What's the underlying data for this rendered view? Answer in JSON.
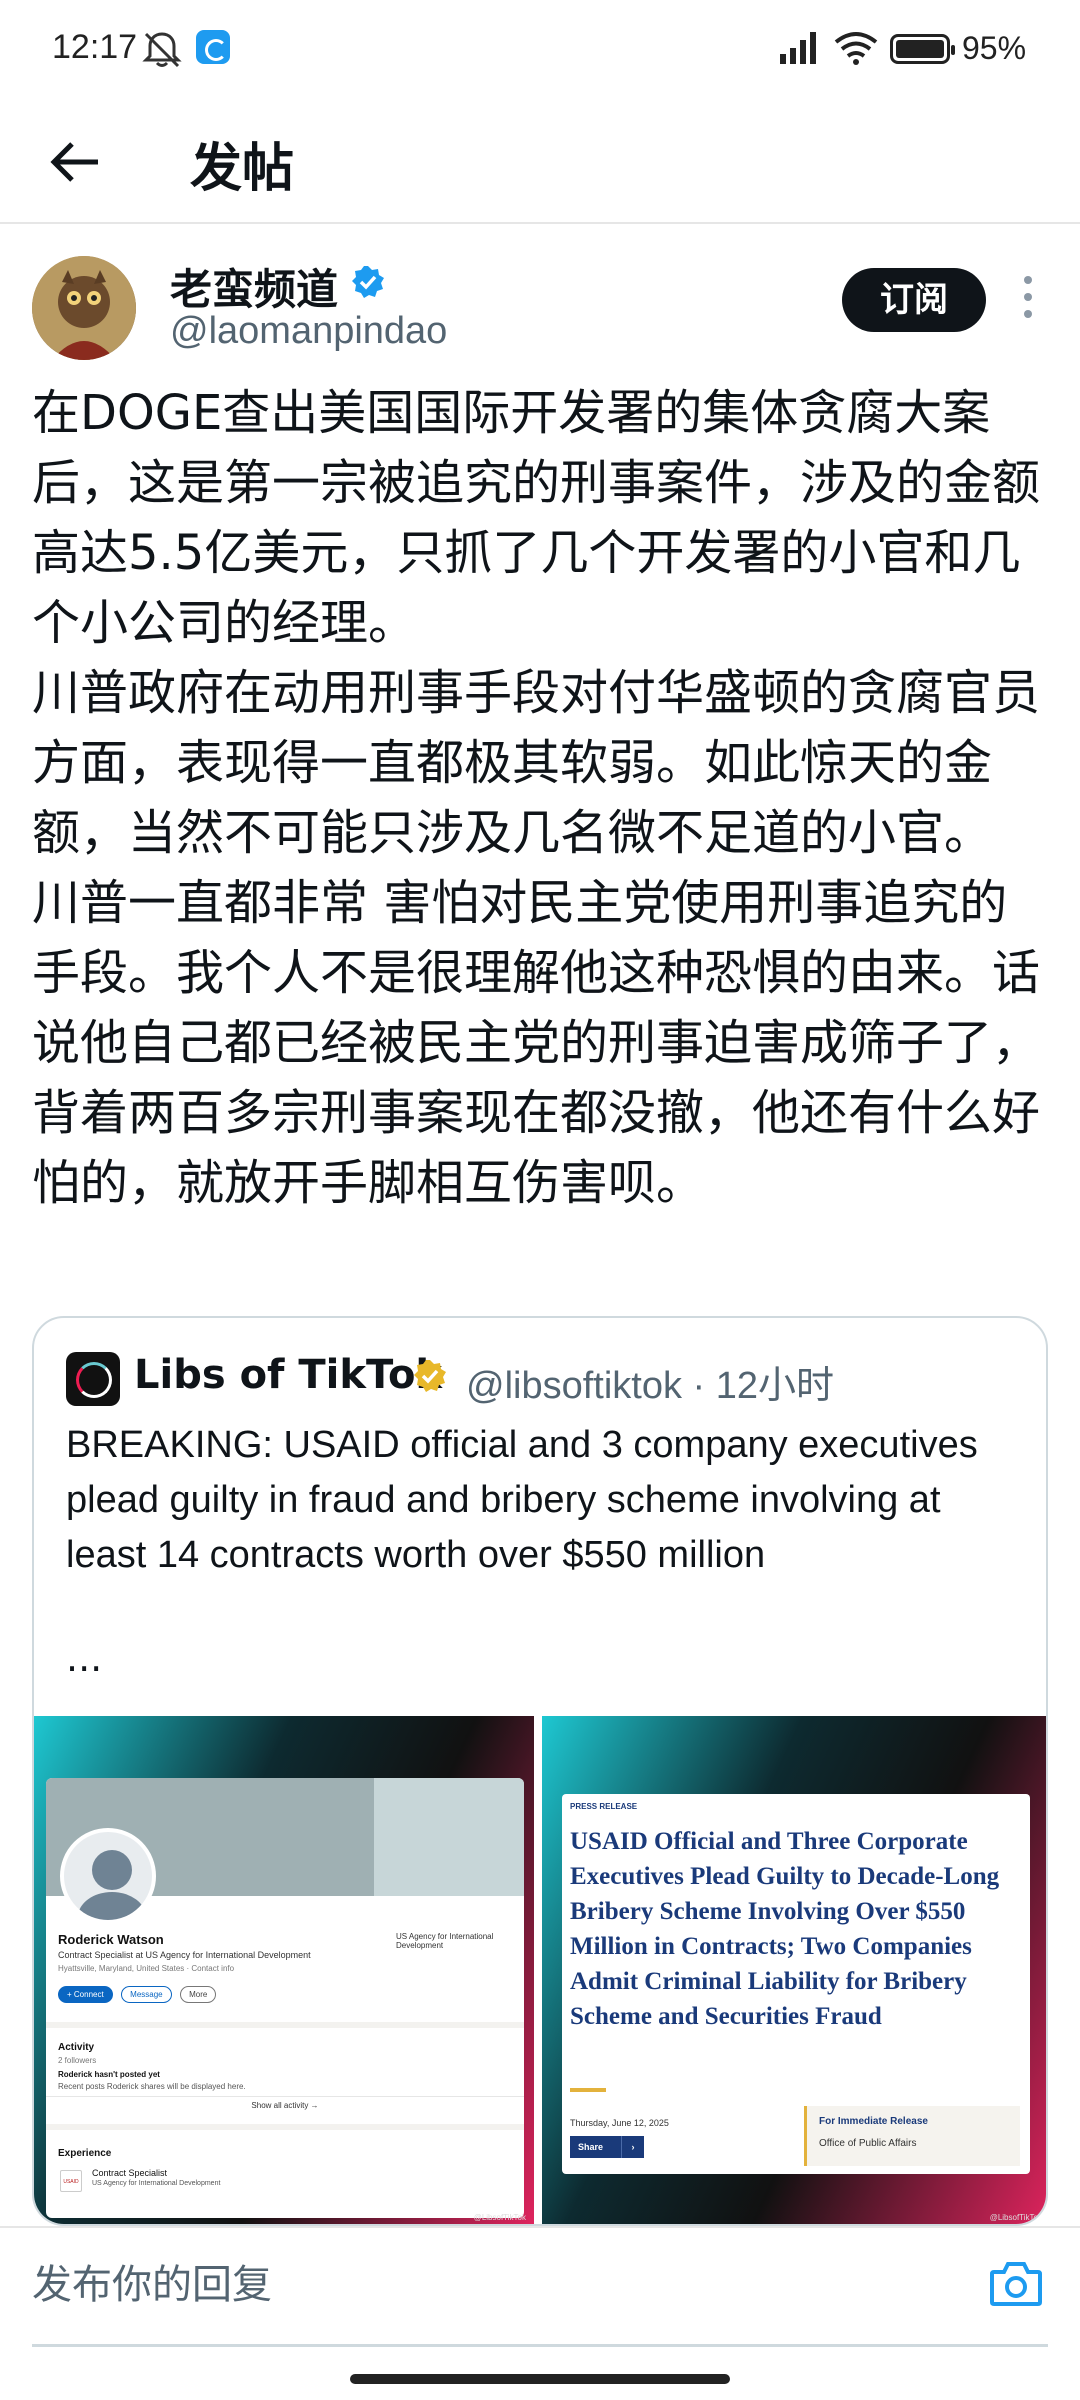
{
  "status_bar": {
    "time": "12:17",
    "battery": "95%",
    "battery_level": 0.95
  },
  "header": {
    "title": "发帖"
  },
  "post": {
    "author_name": "老蛮频道",
    "author_handle": "@laomanpindao",
    "subscribe_label": "订阅",
    "paragraphs": [
      "在DOGE查出美国国际开发署的集体贪腐大案后，这是第一宗被追究的刑事案件，涉及的金额高达5.5亿美元，只抓了几个开发署的小官和几个小公司的经理。",
      "川普政府在动用刑事手段对付华盛顿的贪腐官员方面，表现得一直都极其软弱。如此惊天的金额，当然不可能只涉及几名微不足道的小官。",
      "川普一直都非常 害怕对民主党使用刑事追究的手段。我个人不是很理解他这种恐惧的由来。话说他自己都已经被民主党的刑事迫害成筛子了，背着两百多宗刑事案现在都没撤，他还有什么好怕的，就放开手脚相互伤害呗。"
    ]
  },
  "quote": {
    "name": "Libs of TikTok",
    "handle_time": "@libsoftiktok · 12小时",
    "text": "BREAKING: USAID official and 3 company executives plead guilty in fraud and bribery scheme involving at least 14 contracts worth over $550 million",
    "ellipsis": "...",
    "image_left": {
      "name": "Roderick Watson",
      "role": "Contract Specialist at US Agency for International Development",
      "location": "Hyattsville, Maryland, United States · Contact info",
      "org": "US Agency for International Development",
      "btn_connect": "+ Connect",
      "btn_message": "Message",
      "btn_more": "More",
      "activity_label": "Activity",
      "followers": "2 followers",
      "not_posted": "Roderick hasn't posted yet",
      "not_posted_sub": "Recent posts Roderick shares will be displayed here.",
      "show_all": "Show all activity →",
      "experience_label": "Experience",
      "exp_logo": "USAID",
      "exp_role": "Contract Specialist",
      "exp_org": "US Agency for International Development",
      "watermark": "@LibsofTikTok"
    },
    "image_right": {
      "label": "PRESS RELEASE",
      "title": "USAID Official and Three Corporate Executives Plead Guilty to Decade-Long Bribery Scheme Involving Over $550 Million in Contracts; Two Companies Admit Criminal Liability for Bribery Scheme and Securities Fraud",
      "date": "Thursday, June 12, 2025",
      "share": "Share",
      "box_a": "For Immediate Release",
      "box_b": "Office of Public Affairs",
      "watermark": "@LibsofTikTok"
    }
  },
  "reply": {
    "placeholder": "发布你的回复"
  },
  "colors": {
    "accent_blue": "#1d9bf0",
    "gold_verified": "#e8b829",
    "subscribe_bg": "#0f1419"
  }
}
